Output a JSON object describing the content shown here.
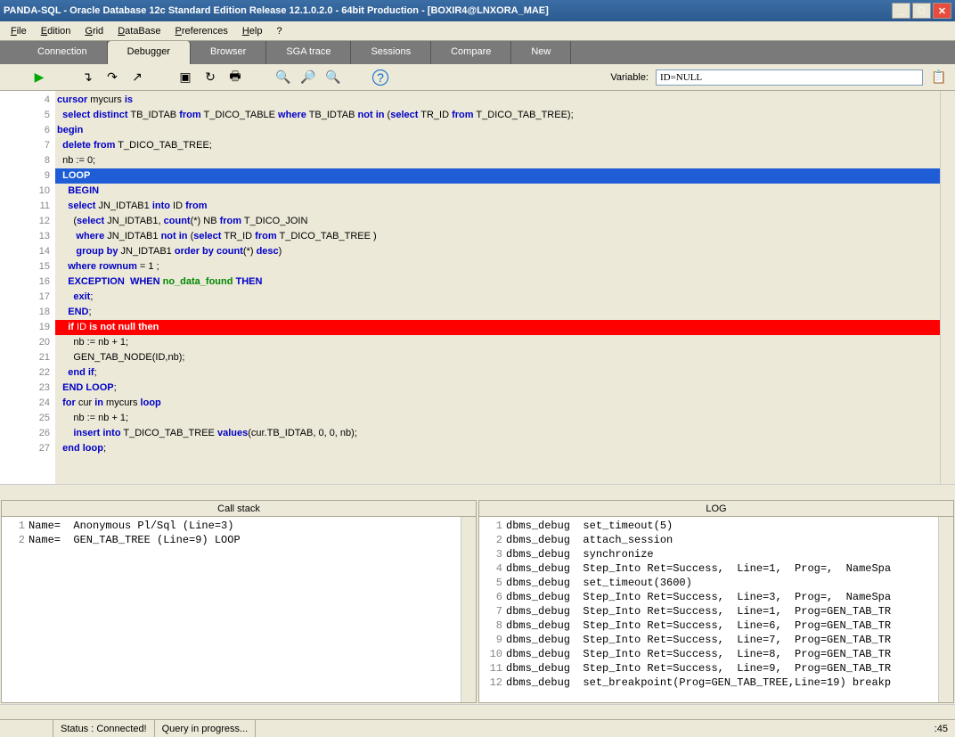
{
  "window": {
    "title": "PANDA-SQL - Oracle Database 12c Standard Edition Release 12.1.0.2.0 - 64bit Production - [BOXIR4@LNXORA_MAE]"
  },
  "menu": {
    "file": "File",
    "edition": "Edition",
    "grid": "Grid",
    "database": "DataBase",
    "preferences": "Preferences",
    "help": "Help",
    "q": "?"
  },
  "tabs": {
    "connection": "Connection",
    "debugger": "Debugger",
    "browser": "Browser",
    "sgatrace": "SGA trace",
    "sessions": "Sessions",
    "compare": "Compare",
    "new": "New"
  },
  "toolbar": {
    "variable_label": "Variable:",
    "variable_value": "ID=NULL"
  },
  "code": {
    "lines": [
      {
        "n": 4,
        "seg": [
          {
            "t": "cursor",
            "c": "kw"
          },
          {
            "t": " mycurs "
          },
          {
            "t": "is",
            "c": "kw"
          }
        ]
      },
      {
        "n": 5,
        "seg": [
          {
            "t": "  "
          },
          {
            "t": "select",
            "c": "kw"
          },
          {
            "t": " "
          },
          {
            "t": "distinct",
            "c": "kw"
          },
          {
            "t": " TB_IDTAB "
          },
          {
            "t": "from",
            "c": "kw"
          },
          {
            "t": " T_DICO_TABLE "
          },
          {
            "t": "where",
            "c": "kw"
          },
          {
            "t": " TB_IDTAB "
          },
          {
            "t": "not",
            "c": "kw"
          },
          {
            "t": " "
          },
          {
            "t": "in",
            "c": "kw"
          },
          {
            "t": " ("
          },
          {
            "t": "select",
            "c": "kw"
          },
          {
            "t": " TR_ID "
          },
          {
            "t": "from",
            "c": "kw"
          },
          {
            "t": " T_DICO_TAB_TREE);"
          }
        ]
      },
      {
        "n": 6,
        "seg": [
          {
            "t": "begin",
            "c": "kw"
          }
        ]
      },
      {
        "n": 7,
        "seg": [
          {
            "t": "  "
          },
          {
            "t": "delete",
            "c": "kw"
          },
          {
            "t": " "
          },
          {
            "t": "from",
            "c": "kw"
          },
          {
            "t": " T_DICO_TAB_TREE;"
          }
        ]
      },
      {
        "n": 8,
        "seg": [
          {
            "t": "  nb := 0;"
          }
        ]
      },
      {
        "n": 9,
        "hl": "blue",
        "mark": "arrow",
        "seg": [
          {
            "t": "  "
          },
          {
            "t": "LOOP",
            "c": "kw"
          }
        ]
      },
      {
        "n": 10,
        "seg": [
          {
            "t": "    "
          },
          {
            "t": "BEGIN",
            "c": "kw"
          }
        ]
      },
      {
        "n": 11,
        "seg": [
          {
            "t": "    "
          },
          {
            "t": "select",
            "c": "kw"
          },
          {
            "t": " JN_IDTAB1 "
          },
          {
            "t": "into",
            "c": "kw"
          },
          {
            "t": " ID "
          },
          {
            "t": "from",
            "c": "kw"
          }
        ]
      },
      {
        "n": 12,
        "seg": [
          {
            "t": "      ("
          },
          {
            "t": "select",
            "c": "kw"
          },
          {
            "t": " JN_IDTAB1, "
          },
          {
            "t": "count",
            "c": "kw"
          },
          {
            "t": "(*) NB "
          },
          {
            "t": "from",
            "c": "kw"
          },
          {
            "t": " T_DICO_JOIN"
          }
        ]
      },
      {
        "n": 13,
        "seg": [
          {
            "t": "       "
          },
          {
            "t": "where",
            "c": "kw"
          },
          {
            "t": " JN_IDTAB1 "
          },
          {
            "t": "not",
            "c": "kw"
          },
          {
            "t": " "
          },
          {
            "t": "in",
            "c": "kw"
          },
          {
            "t": " ("
          },
          {
            "t": "select",
            "c": "kw"
          },
          {
            "t": " TR_ID "
          },
          {
            "t": "from",
            "c": "kw"
          },
          {
            "t": " T_DICO_TAB_TREE )"
          }
        ]
      },
      {
        "n": 14,
        "seg": [
          {
            "t": "       "
          },
          {
            "t": "group",
            "c": "kw"
          },
          {
            "t": " "
          },
          {
            "t": "by",
            "c": "kw"
          },
          {
            "t": " JN_IDTAB1 "
          },
          {
            "t": "order",
            "c": "kw"
          },
          {
            "t": " "
          },
          {
            "t": "by",
            "c": "kw"
          },
          {
            "t": " "
          },
          {
            "t": "count",
            "c": "kw"
          },
          {
            "t": "(*) "
          },
          {
            "t": "desc",
            "c": "kw"
          },
          {
            "t": ")"
          }
        ]
      },
      {
        "n": 15,
        "seg": [
          {
            "t": "    "
          },
          {
            "t": "where",
            "c": "kw"
          },
          {
            "t": " "
          },
          {
            "t": "rownum",
            "c": "kw"
          },
          {
            "t": " = 1 ;"
          }
        ]
      },
      {
        "n": 16,
        "seg": [
          {
            "t": "    "
          },
          {
            "t": "EXCEPTION",
            "c": "kw"
          },
          {
            "t": "  "
          },
          {
            "t": "WHEN",
            "c": "kw"
          },
          {
            "t": " "
          },
          {
            "t": "no_data_found",
            "c": "kwg"
          },
          {
            "t": " "
          },
          {
            "t": "THEN",
            "c": "kw"
          }
        ]
      },
      {
        "n": 17,
        "seg": [
          {
            "t": "      "
          },
          {
            "t": "exit",
            "c": "kw"
          },
          {
            "t": ";"
          }
        ]
      },
      {
        "n": 18,
        "seg": [
          {
            "t": "    "
          },
          {
            "t": "END",
            "c": "kw"
          },
          {
            "t": ";"
          }
        ]
      },
      {
        "n": 19,
        "hl": "red",
        "mark": "bp",
        "seg": [
          {
            "t": "    "
          },
          {
            "t": "if",
            "c": "kw"
          },
          {
            "t": " ID "
          },
          {
            "t": "is",
            "c": "kw"
          },
          {
            "t": " "
          },
          {
            "t": "not",
            "c": "kw"
          },
          {
            "t": " "
          },
          {
            "t": "null",
            "c": "kw"
          },
          {
            "t": " "
          },
          {
            "t": "then",
            "c": "kw"
          }
        ]
      },
      {
        "n": 20,
        "seg": [
          {
            "t": "      nb := nb + 1;"
          }
        ]
      },
      {
        "n": 21,
        "seg": [
          {
            "t": "      GEN_TAB_NODE(ID,nb);"
          }
        ]
      },
      {
        "n": 22,
        "seg": [
          {
            "t": "    "
          },
          {
            "t": "end",
            "c": "kw"
          },
          {
            "t": " "
          },
          {
            "t": "if",
            "c": "kw"
          },
          {
            "t": ";"
          }
        ]
      },
      {
        "n": 23,
        "seg": [
          {
            "t": "  "
          },
          {
            "t": "END",
            "c": "kw"
          },
          {
            "t": " "
          },
          {
            "t": "LOOP",
            "c": "kw"
          },
          {
            "t": ";"
          }
        ]
      },
      {
        "n": 24,
        "seg": [
          {
            "t": "  "
          },
          {
            "t": "for",
            "c": "kw"
          },
          {
            "t": " cur "
          },
          {
            "t": "in",
            "c": "kw"
          },
          {
            "t": " mycurs "
          },
          {
            "t": "loop",
            "c": "kw"
          }
        ]
      },
      {
        "n": 25,
        "seg": [
          {
            "t": "      nb := nb + 1;"
          }
        ]
      },
      {
        "n": 26,
        "seg": [
          {
            "t": "      "
          },
          {
            "t": "insert",
            "c": "kw"
          },
          {
            "t": " "
          },
          {
            "t": "into",
            "c": "kw"
          },
          {
            "t": " T_DICO_TAB_TREE "
          },
          {
            "t": "values",
            "c": "kw"
          },
          {
            "t": "(cur.TB_IDTAB, 0, 0, nb);"
          }
        ]
      },
      {
        "n": 27,
        "seg": [
          {
            "t": "  "
          },
          {
            "t": "end",
            "c": "kw"
          },
          {
            "t": " "
          },
          {
            "t": "loop",
            "c": "kw"
          },
          {
            "t": ";"
          }
        ]
      }
    ]
  },
  "callstack": {
    "title": "Call stack",
    "rows": [
      {
        "n": 1,
        "t": "Name=  Anonymous Pl/Sql (Line=3)"
      },
      {
        "n": 2,
        "t": "Name=  GEN_TAB_TREE (Line=9) LOOP"
      }
    ]
  },
  "log": {
    "title": "LOG",
    "rows": [
      {
        "n": 1,
        "t": "dbms_debug  set_timeout(5)"
      },
      {
        "n": 2,
        "t": "dbms_debug  attach_session"
      },
      {
        "n": 3,
        "t": "dbms_debug  synchronize"
      },
      {
        "n": 4,
        "t": "dbms_debug  Step_Into Ret=Success,  Line=1,  Prog=,  NameSpa"
      },
      {
        "n": 5,
        "t": "dbms_debug  set_timeout(3600)"
      },
      {
        "n": 6,
        "t": "dbms_debug  Step_Into Ret=Success,  Line=3,  Prog=,  NameSpa"
      },
      {
        "n": 7,
        "t": "dbms_debug  Step_Into Ret=Success,  Line=1,  Prog=GEN_TAB_TR"
      },
      {
        "n": 8,
        "t": "dbms_debug  Step_Into Ret=Success,  Line=6,  Prog=GEN_TAB_TR"
      },
      {
        "n": 9,
        "t": "dbms_debug  Step_Into Ret=Success,  Line=7,  Prog=GEN_TAB_TR"
      },
      {
        "n": 10,
        "t": "dbms_debug  Step_Into Ret=Success,  Line=8,  Prog=GEN_TAB_TR"
      },
      {
        "n": 11,
        "t": "dbms_debug  Step_Into Ret=Success,  Line=9,  Prog=GEN_TAB_TR"
      },
      {
        "n": 12,
        "t": "dbms_debug  set_breakpoint(Prog=GEN_TAB_TREE,Line=19) breakp"
      }
    ]
  },
  "status": {
    "connected": "Status : Connected!",
    "query": "Query in progress...",
    "time": ":45"
  }
}
